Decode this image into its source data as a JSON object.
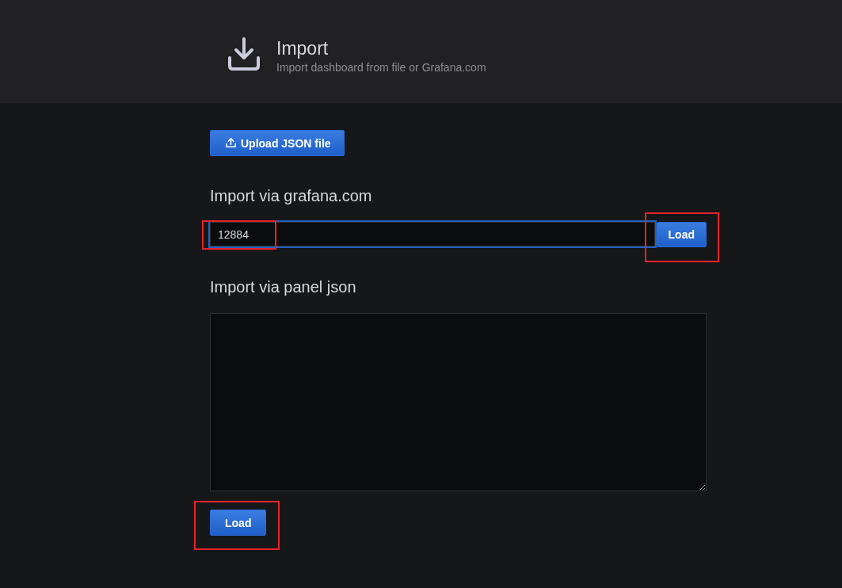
{
  "header": {
    "title": "Import",
    "subtitle": "Import dashboard from file or Grafana.com"
  },
  "upload_button": {
    "label": "Upload JSON file"
  },
  "grafana_import": {
    "heading": "Import via grafana.com",
    "input": {
      "value": "12884",
      "focused": true
    },
    "button": "Load"
  },
  "panel_json_import": {
    "heading": "Import via panel json",
    "button": "Load"
  }
}
